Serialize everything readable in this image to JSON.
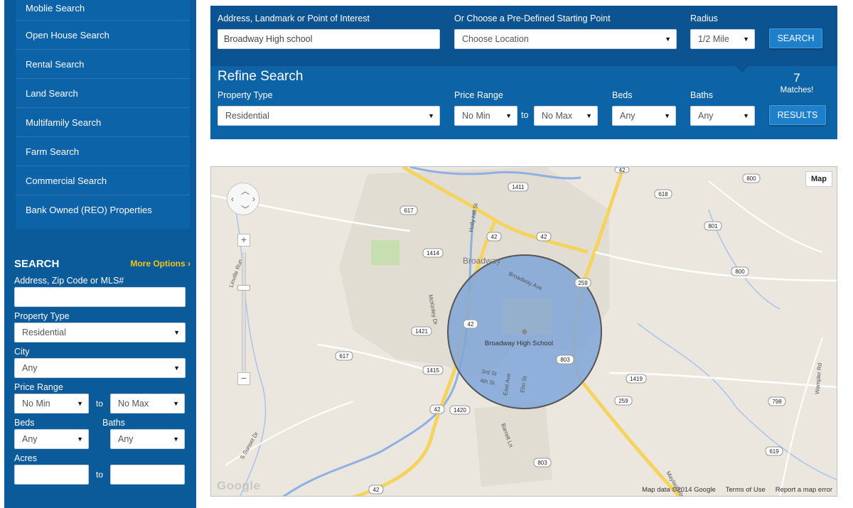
{
  "sidebar": {
    "menu": [
      "Moblie Search",
      "Open House Search",
      "Rental Search",
      "Land Search",
      "Multifamily Search",
      "Farm Search",
      "Commercial Search",
      "Bank Owned (REO) Properties"
    ],
    "search": {
      "title": "SEARCH",
      "more_options": "More Options ›",
      "address_label": "Address, Zip Code or MLS#",
      "address_value": "",
      "property_type_label": "Property Type",
      "property_type_value": "Residential",
      "city_label": "City",
      "city_value": "Any",
      "price_range_label": "Price Range",
      "price_min": "No Min",
      "price_max": "No Max",
      "to": "to",
      "beds_label": "Beds",
      "beds_value": "Any",
      "baths_label": "Baths",
      "baths_value": "Any",
      "acres_label": "Acres"
    }
  },
  "top": {
    "address_label": "Address, Landmark or Point of Interest",
    "address_value": "Broadway High school",
    "predefined_label": "Or Choose a Pre-Defined Starting Point",
    "predefined_value": "Choose Location",
    "radius_label": "Radius",
    "radius_value": "1/2 Mile",
    "search_button": "SEARCH",
    "refine_title": "Refine Search",
    "property_type_label": "Property Type",
    "property_type_value": "Residential",
    "price_range_label": "Price Range",
    "price_min": "No Min",
    "to": "to",
    "price_max": "No Max",
    "beds_label": "Beds",
    "beds_value": "Any",
    "baths_label": "Baths",
    "baths_value": "Any",
    "matches_count": "7",
    "matches_label": "Matches!",
    "results_button": "RESULTS"
  },
  "map": {
    "type_button": "Map",
    "zoom_in": "+",
    "zoom_out": "−",
    "town_label": "Broadway",
    "school_label": "Broadway High School",
    "street_labels": [
      "Broadway Ave",
      "Holly Hill St",
      "McKinley Dr",
      "3rd St",
      "4th St",
      "East Ave",
      "Elm St",
      "Barrett Ln",
      "S Sunset Dr",
      "Wampler Rd",
      "Mayland Rd",
      "Linville Run"
    ],
    "route_shields": [
      "1411",
      "617",
      "42",
      "1414",
      "42",
      "42",
      "259",
      "1421",
      "617",
      "1415",
      "42",
      "1420",
      "803",
      "259",
      "1419",
      "803",
      "42",
      "618",
      "800",
      "801",
      "800",
      "798",
      "619",
      "42"
    ],
    "footer_data": "Map data ©2014 Google",
    "footer_terms": "Terms of Use",
    "footer_report": "Report a map error",
    "logo_text": "Google"
  },
  "colors": {
    "sidebar_bg": "#0b5a99",
    "panel_bg": "#0c63a6",
    "accent_yellow": "#f5c518",
    "radius_fill": "#7fa6d9"
  }
}
